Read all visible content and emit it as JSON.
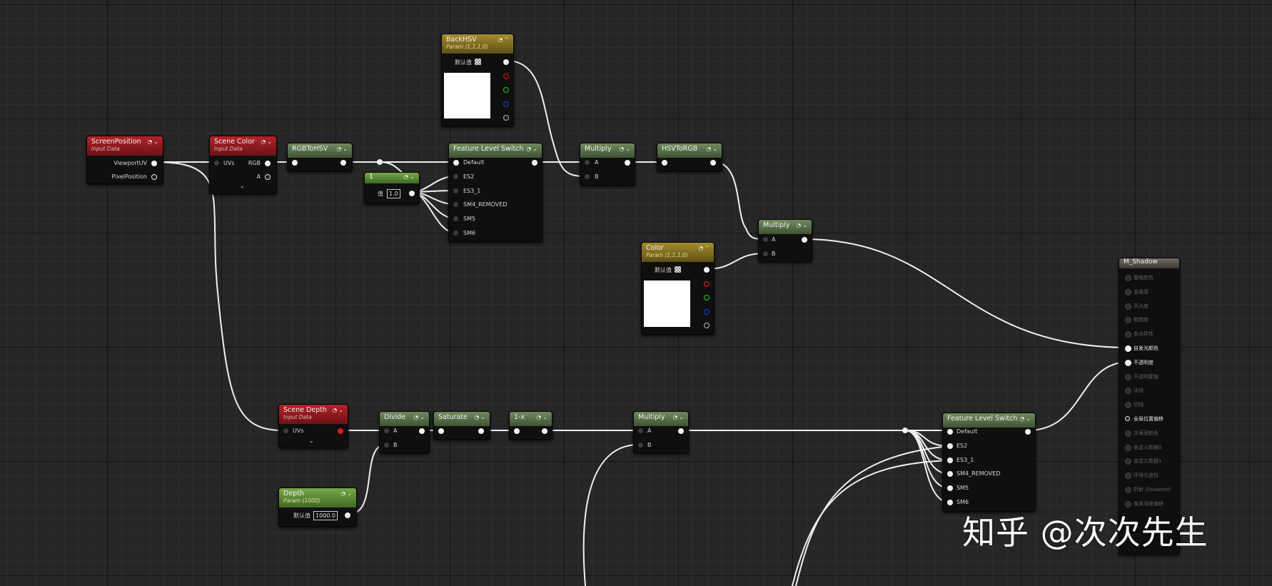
{
  "nodes": {
    "screen_position": {
      "title": "ScreenPosition",
      "subtitle": "Input Data",
      "outputs": [
        "ViewportUV",
        "PixelPosition"
      ]
    },
    "scene_color": {
      "title": "Scene Color",
      "subtitle": "Input Data",
      "input": "UVs",
      "outputs": [
        "RGB",
        "A"
      ]
    },
    "rgb_to_hsv": {
      "title": "RGBToHSV"
    },
    "back_hsv": {
      "title": "BackHSV",
      "subtitle": "Param (1,1,1,0)",
      "default_label": "默认值"
    },
    "feature_switch_top": {
      "title": "Feature Level Switch",
      "inputs": [
        "Default",
        "ES2",
        "ES3_1",
        "SM4_REMOVED",
        "SM5",
        "SM6"
      ]
    },
    "constant_one": {
      "title": "1",
      "value_label": "值",
      "value": "1.0"
    },
    "multiply_top": {
      "title": "Multiply",
      "inputs": [
        "A",
        "B"
      ]
    },
    "hsv_to_rgb": {
      "title": "HSVToRGB"
    },
    "multiply_mid": {
      "title": "Multiply",
      "inputs": [
        "A",
        "B"
      ]
    },
    "color_param": {
      "title": "Color",
      "subtitle": "Param (1,1,1,0)",
      "default_label": "默认值"
    },
    "scene_depth": {
      "title": "Scene Depth",
      "subtitle": "Input Data",
      "input": "UVs"
    },
    "divide": {
      "title": "Divide",
      "inputs": [
        "A",
        "B"
      ]
    },
    "saturate": {
      "title": "Saturate"
    },
    "one_minus": {
      "title": "1-x"
    },
    "multiply_bottom": {
      "title": "Multiply",
      "inputs": [
        "A",
        "B"
      ]
    },
    "depth_param": {
      "title": "Depth",
      "subtitle": "Param (1000)",
      "default_label": "默认值",
      "value": "1000.0"
    },
    "feature_switch_bottom": {
      "title": "Feature Level Switch",
      "inputs": [
        "Default",
        "ES2",
        "ES3_1",
        "SM4_REMOVED",
        "SM5",
        "SM6"
      ]
    },
    "material": {
      "title": "M_Shadow",
      "pins": [
        "基础颜色",
        "金属感",
        "高光度",
        "粗糙度",
        "各向异性",
        "自发光颜色",
        "不透明度",
        "不透明蒙版",
        "法线",
        "切线",
        "全局位置偏移",
        "次表面颜色",
        "自定义数据0",
        "自定义数据1",
        "环境光遮挡",
        "折射 (Disabled)",
        "像素深度偏移"
      ],
      "active_pins": [
        "自发光颜色",
        "不透明度"
      ],
      "hollow_pins": [
        "全局位置偏移"
      ]
    }
  },
  "watermark": "知乎 @次次先生",
  "colors": {
    "wire": "#f0f0f0",
    "input_header": "#b3232b",
    "function_header": "#5f7a50",
    "param_header": "#a48b2e",
    "constant_header": "#6aa140"
  }
}
